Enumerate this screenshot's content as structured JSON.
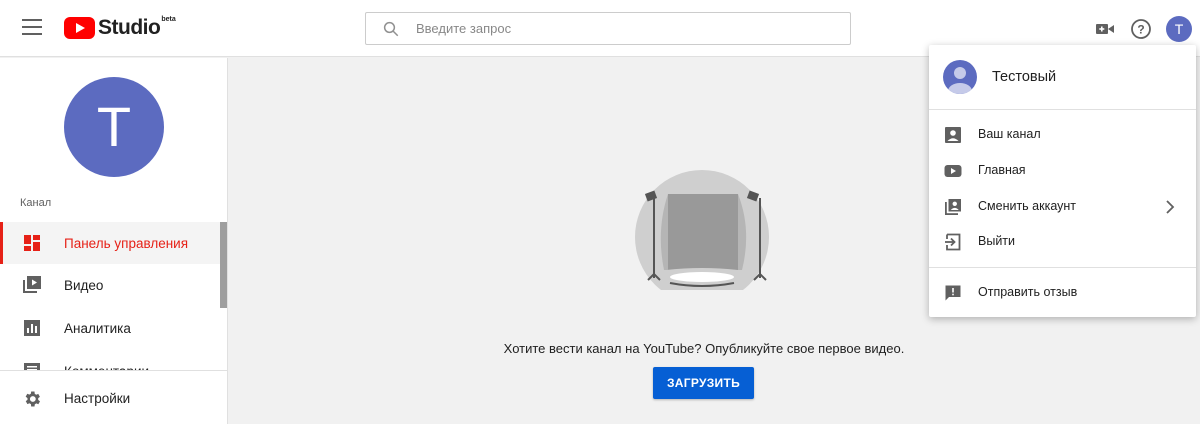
{
  "header": {
    "logo_text": "Studio",
    "logo_badge": "beta",
    "search_placeholder": "Введите запрос",
    "avatar_letter": "T",
    "icons": [
      "menu-icon",
      "youtube-play-icon",
      "search-icon",
      "create-video-icon",
      "help-icon"
    ]
  },
  "sidebar": {
    "avatar_letter": "T",
    "section_label": "Канал",
    "items": [
      {
        "label": "Панель управления",
        "icon": "dashboard-icon",
        "active": true
      },
      {
        "label": "Видео",
        "icon": "video-library-icon",
        "active": false
      },
      {
        "label": "Аналитика",
        "icon": "analytics-icon",
        "active": false
      },
      {
        "label": "Комментарии",
        "icon": "comments-icon",
        "active": false
      }
    ],
    "settings_label": "Настройки"
  },
  "main": {
    "empty_text": "Хотите вести канал на YouTube? Опубликуйте свое первое видео.",
    "upload_label": "ЗАГРУЗИТЬ"
  },
  "account_menu": {
    "name": "Тестовый",
    "items": [
      {
        "label": "Ваш канал",
        "icon": "account-box-icon"
      },
      {
        "label": "Главная",
        "icon": "youtube-icon"
      },
      {
        "label": "Сменить аккаунт",
        "icon": "switch-account-icon",
        "has_submenu": true
      },
      {
        "label": "Выйти",
        "icon": "exit-icon"
      },
      {
        "label": "Отправить отзыв",
        "icon": "feedback-icon"
      }
    ]
  },
  "colors": {
    "brand_red": "#ff0000",
    "active_red": "#e62117",
    "avatar_purple": "#5c6bc0",
    "upload_blue": "#065fd4",
    "icon_gray": "#606060"
  }
}
